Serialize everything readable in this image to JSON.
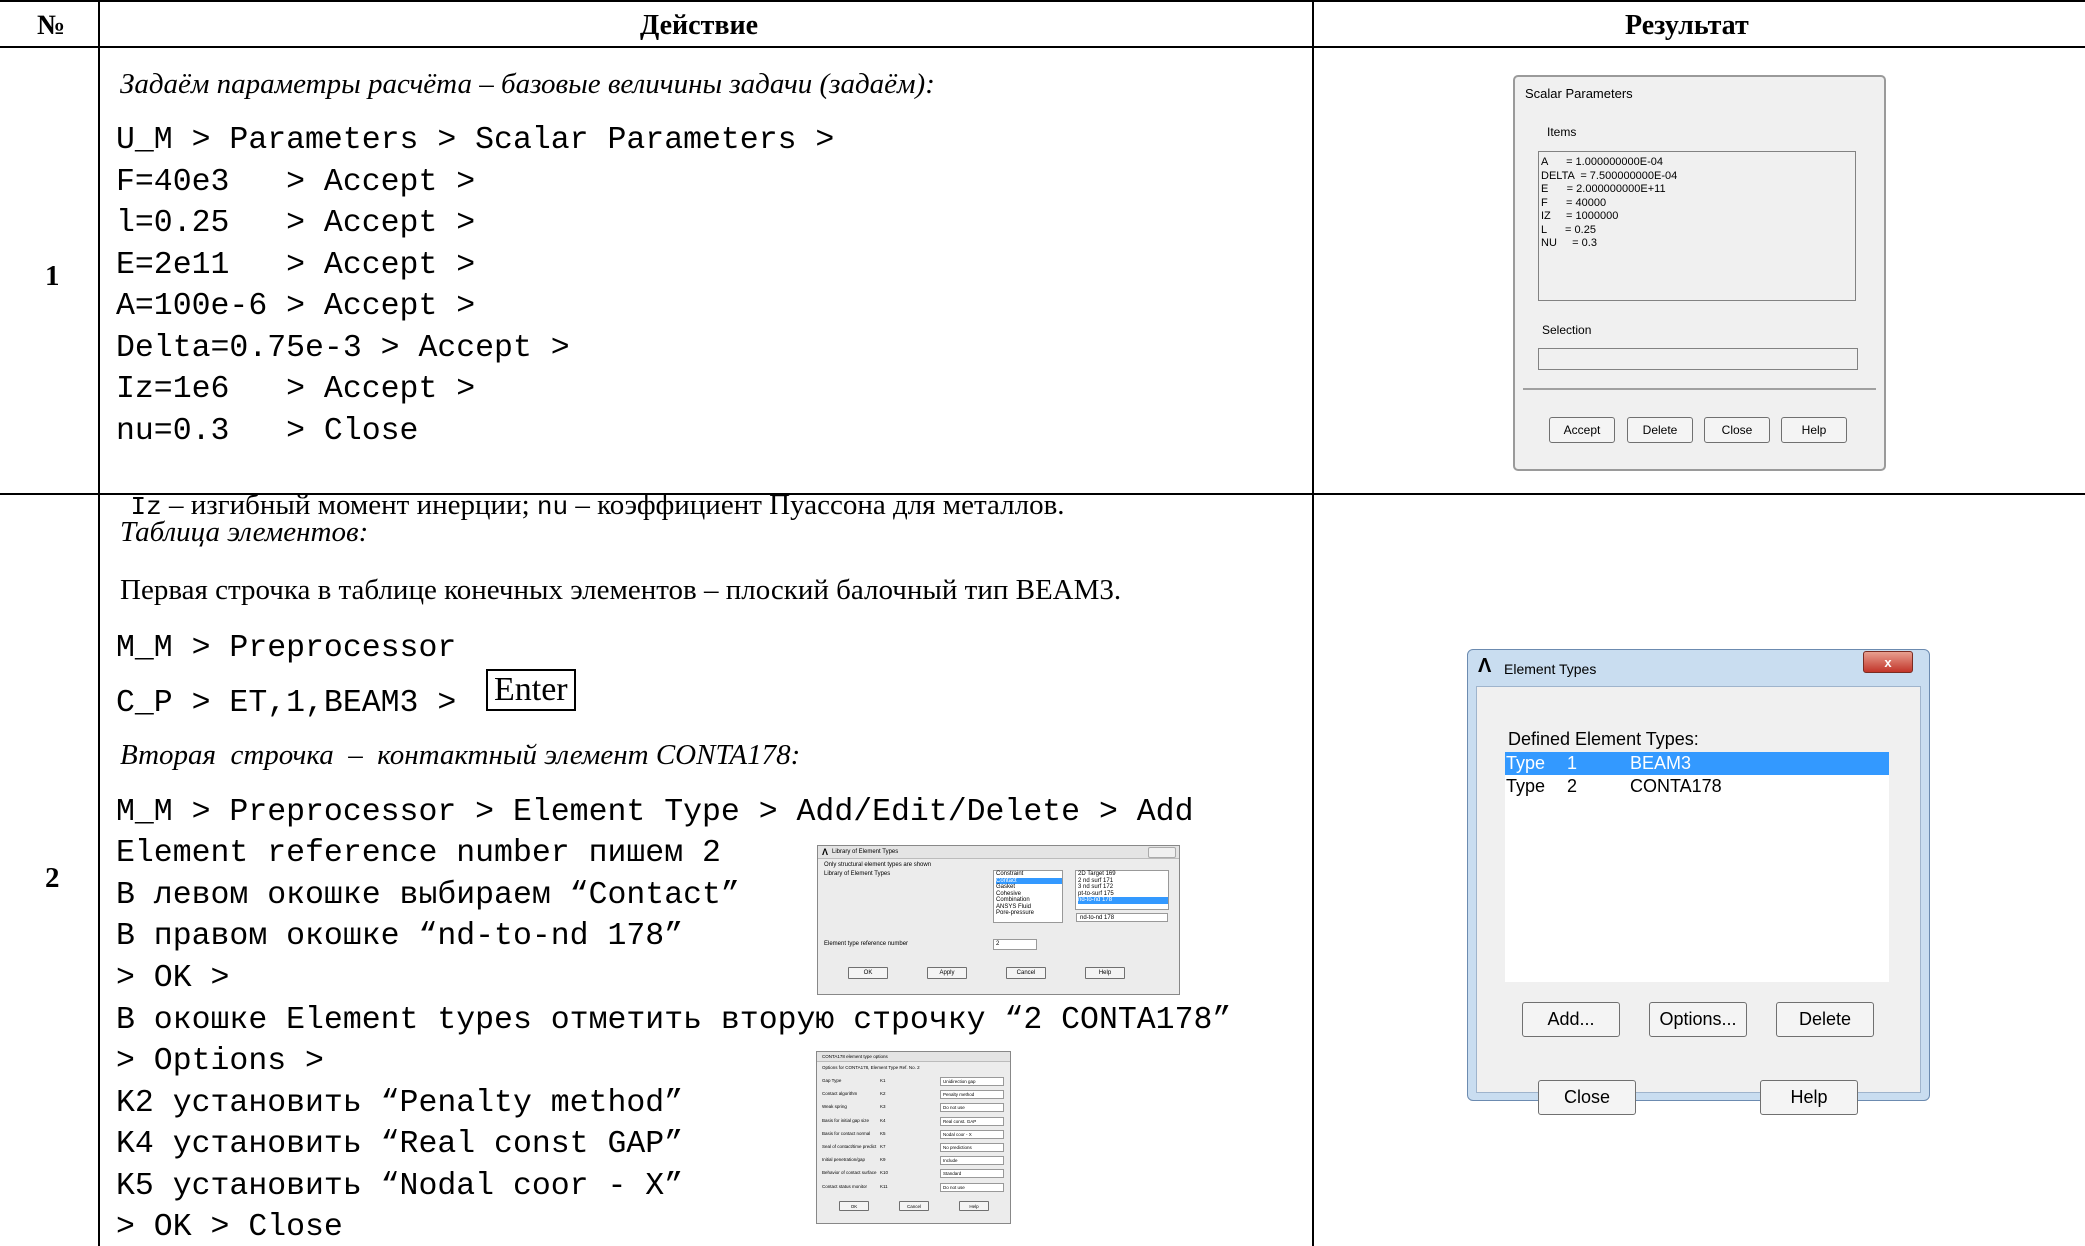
{
  "header": {
    "num": "№",
    "action": "Действие",
    "result": "Результат"
  },
  "rows": [
    {
      "num": "1",
      "intro": "Задаём параметры расчёта – базовые величины задачи (задаём):",
      "lines": [
        "U_M > Parameters > Scalar Parameters >",
        "F=40e3   > Accept >",
        "l=0.25   > Accept >",
        "E=2e11   > Accept >",
        "A=100e-6 > Accept >",
        "Delta=0.75e-3 > Accept >",
        "Iz=1e6   > Accept >",
        "nu=0.3   > Close"
      ],
      "note": {
        "a": "Iz",
        "b": " – изгибный момент инерции; ",
        "c": "nu",
        "d": " – коэффициент Пуассона для металлов."
      },
      "dialog": {
        "title": "Scalar Parameters",
        "items_label": "Items",
        "items": [
          "A      = 1.000000000E-04",
          "DELTA  = 7.500000000E-04",
          "E      = 2.000000000E+11",
          "F      = 40000",
          "IZ     = 1000000",
          "L      = 0.25",
          "NU     = 0.3"
        ],
        "selection_label": "Selection",
        "buttons": [
          "Accept",
          "Delete",
          "Close",
          "Help"
        ]
      }
    },
    {
      "num": "2",
      "intro": "Таблица элементов:",
      "first_line": "Первая строчка в таблице конечных элементов – плоский балочный тип BEAM3.",
      "cmd1": "M_M > Preprocessor",
      "cmd2": "C_P > ET,1,BEAM3 >",
      "enter": "Enter",
      "second_intro": "Вторая  строчка  –  контактный элемент CONTA178:",
      "lines_a": [
        "M_M > Preprocessor > Element Type > Add/Edit/Delete > Add",
        "Element reference number пишем 2",
        "В левом окошке выбираем “Contact”",
        "В правом окошке “nd-to-nd 178”",
        "> OK >",
        "В окошке Element types отметить вторую строчку “2 CONTA178”",
        "> Options >",
        "K2 установить “Penalty method”",
        "K4 установить “Real const GAP”",
        "K5 установить “Nodal coor - X”",
        "> OK > Close"
      ],
      "lib_dialog": {
        "title": "Library of Element Types",
        "note": "Only structural element types are shown",
        "label": "Library of Element Types",
        "left_list": [
          "Constraint",
          "Contact",
          "Gasket",
          "Cohesive",
          "Combination",
          "ANSYS Fluid",
          "Pore-pressure"
        ],
        "right_list": [
          "2D Target  169",
          "2 nd surf  171",
          "3 nd surf  172",
          "pt-to-surf  175",
          "nd-to-nd  178"
        ],
        "right_selected": "nd-to-nd  178",
        "ref_label": "Element type reference number",
        "ref_value": "2",
        "buttons": [
          "OK",
          "Apply",
          "Cancel",
          "Help"
        ]
      },
      "opt_dialog": {
        "title": "CONTA178 element type options",
        "heading": "Options for CONTA178, Element Type Ref. No. 2",
        "rows": [
          {
            "label": "Gap Type",
            "key": "K1",
            "value": "Unidirection gap"
          },
          {
            "label": "Contact algorithm",
            "key": "K2",
            "value": "Penalty method"
          },
          {
            "label": "Weak spring",
            "key": "K3",
            "value": "Do not use"
          },
          {
            "label": "Basis for initial gap size",
            "key": "K4",
            "value": "Real const. GAP"
          },
          {
            "label": "Basis for contact normal",
            "key": "K5",
            "value": "Nodal coor - X"
          },
          {
            "label": "Seal of contact/time predict",
            "key": "K7",
            "value": "No predictions"
          },
          {
            "label": "Initial penetration/gap",
            "key": "K9",
            "value": "Include"
          },
          {
            "label": "Behavior of contact surface",
            "key": "K10",
            "value": "Standard"
          },
          {
            "label": "Contact status monitor",
            "key": "K11",
            "value": "Do not use"
          }
        ],
        "buttons": [
          "OK",
          "Cancel",
          "Help"
        ]
      },
      "et_dialog": {
        "title": "Element Types",
        "label": "Defined Element Types:",
        "rows": [
          {
            "type": "Type",
            "num": "1",
            "name": "BEAM3"
          },
          {
            "type": "Type",
            "num": "2",
            "name": "CONTA178"
          }
        ],
        "buttons_top": [
          "Add...",
          "Options...",
          "Delete"
        ],
        "buttons_bottom": [
          "Close",
          "Help"
        ],
        "close_glyph": "x"
      }
    }
  ]
}
